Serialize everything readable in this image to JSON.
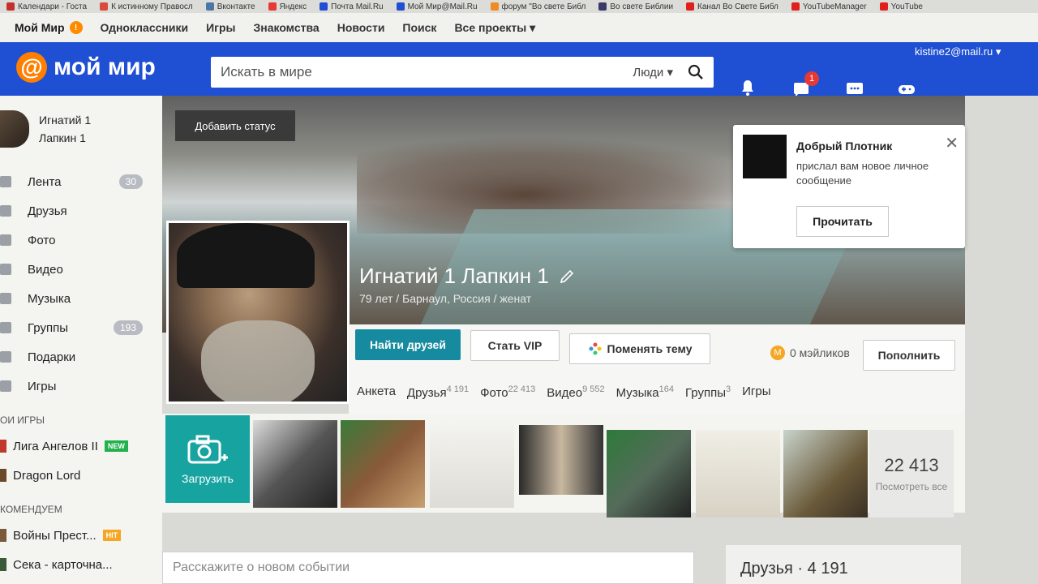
{
  "bookmarks": [
    {
      "label": "Календари - Госта",
      "color": "#c5302c"
    },
    {
      "label": "К истинному Правосл",
      "color": "#d94b3a"
    },
    {
      "label": "Вконтакте",
      "color": "#4a76a8"
    },
    {
      "label": "Яндекс",
      "color": "#e53935"
    },
    {
      "label": "Почта Mail.Ru",
      "color": "#1f4fd2"
    },
    {
      "label": "Мой Мир@Mail.Ru",
      "color": "#1f4fd2"
    },
    {
      "label": "форум \"Во свете Библ",
      "color": "#f08a24"
    },
    {
      "label": "Во свете Библии",
      "color": "#3a3a6a"
    },
    {
      "label": "Канал Во Свете Библ",
      "color": "#e0201c"
    },
    {
      "label": "YouTubeManager",
      "color": "#e0201c"
    },
    {
      "label": "YouTube",
      "color": "#e0201c"
    }
  ],
  "portal": {
    "brand": "Мой Мир",
    "brand_badge": "!",
    "items": [
      "Одноклассники",
      "Игры",
      "Знакомства",
      "Новости",
      "Поиск",
      "Все проекты ▾"
    ]
  },
  "header": {
    "logo_text": "мой мир",
    "search_placeholder": "Искать в мире",
    "search_scope": "Люди ▾",
    "messages_badge": "1",
    "user_email": "kistine2@mail.ru ▾"
  },
  "sidebar": {
    "user_first": "Игнатий 1",
    "user_last": "Лапкин 1",
    "menu": [
      {
        "label": "Лента",
        "count": "30"
      },
      {
        "label": "Друзья",
        "count": ""
      },
      {
        "label": "Фото",
        "count": ""
      },
      {
        "label": "Видео",
        "count": ""
      },
      {
        "label": "Музыка",
        "count": ""
      },
      {
        "label": "Группы",
        "count": "193"
      },
      {
        "label": "Подарки",
        "count": ""
      },
      {
        "label": "Игры",
        "count": ""
      }
    ],
    "my_games_title": "ОИ ИГРЫ",
    "games": [
      {
        "label": "Лига Ангелов II",
        "tag": "NEW"
      },
      {
        "label": "Dragon Lord",
        "tag": ""
      }
    ],
    "recommended_title": "КОМЕНДУЕМ",
    "recommended": [
      {
        "label": "Войны Прест...",
        "tag": "HIT"
      },
      {
        "label": "Сека - карточна...",
        "tag": ""
      }
    ]
  },
  "profile": {
    "status_tip": "Добавить статус",
    "name": "Игнатий 1 Лапкин 1",
    "info": "79 лет / Барнаул, Россия / женат",
    "btn_find_friends": "Найти друзей",
    "btn_vip": "Стать VIP",
    "btn_theme": "Поменять тему",
    "mailiki": "0 мэйликов",
    "btn_topup": "Пополнить",
    "tabs": [
      {
        "label": "Анкета",
        "count": ""
      },
      {
        "label": "Друзья",
        "count": "4 191"
      },
      {
        "label": "Фото",
        "count": "22 413"
      },
      {
        "label": "Видео",
        "count": "9 552"
      },
      {
        "label": "Музыка",
        "count": "164"
      },
      {
        "label": "Группы",
        "count": "3"
      },
      {
        "label": "Игры",
        "count": ""
      }
    ]
  },
  "notification": {
    "title": "Добрый Плотник",
    "body": "прислал вам новое личное сообщение",
    "action": "Прочитать",
    "close": "✕"
  },
  "gallery": {
    "upload_label": "Загрузить",
    "total": "22 413",
    "view_all": "Посмотреть все"
  },
  "composer_placeholder": "Расскажите о новом событии",
  "friends_box_title": "Друзья · 4 191",
  "colors": {
    "brand_blue": "#1f4fd2",
    "teal": "#168b9f",
    "upload_teal": "#17a3a0",
    "badge_orange": "#ff8a00",
    "badge_red": "#e53935"
  }
}
